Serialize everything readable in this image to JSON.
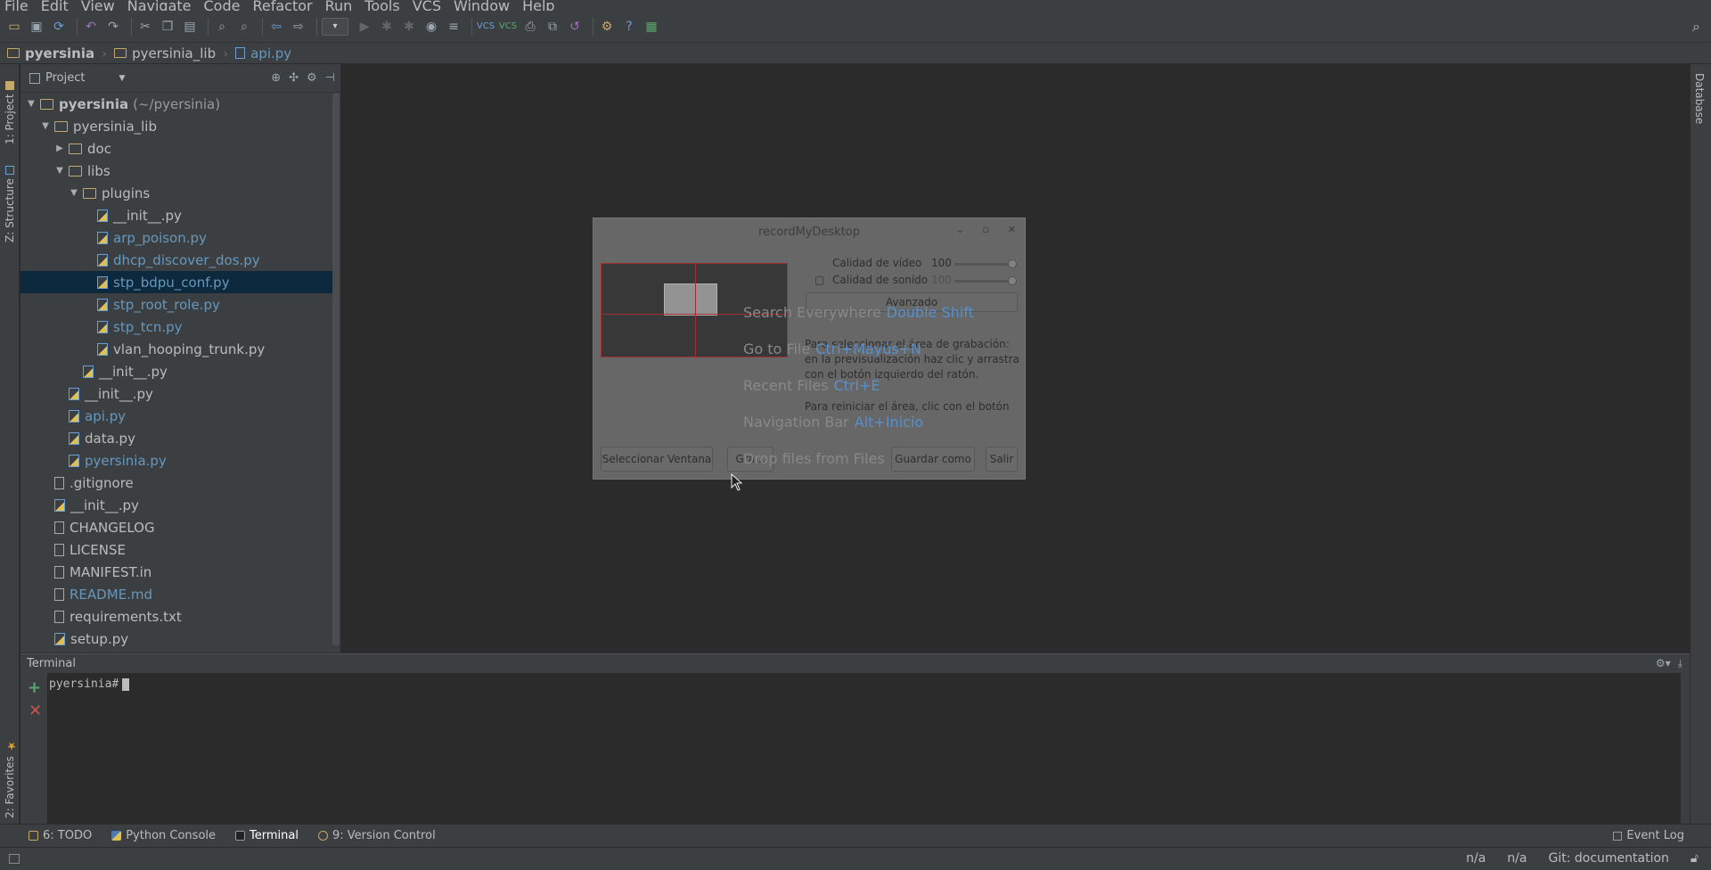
{
  "menu": [
    "File",
    "Edit",
    "View",
    "Navigate",
    "Code",
    "Refactor",
    "Run",
    "Tools",
    "VCS",
    "Window",
    "Help"
  ],
  "breadcrumb": [
    "pyersinia",
    "pyersinia_lib",
    "api.py"
  ],
  "left_tabs": {
    "project": "1: Project",
    "structure": "Z: Structure",
    "favorites": "2: Favorites"
  },
  "right_tabs": {
    "database": "Database"
  },
  "project_panel": {
    "title": "Project"
  },
  "tree": [
    {
      "name": "pyersinia",
      "suffix": "(~/pyersinia)",
      "type": "folder",
      "depth": 0,
      "expanded": true,
      "bold": true
    },
    {
      "name": "pyersinia_lib",
      "type": "folder",
      "depth": 1,
      "expanded": true
    },
    {
      "name": "doc",
      "type": "folder",
      "depth": 2,
      "expanded": false
    },
    {
      "name": "libs",
      "type": "folder",
      "depth": 2,
      "expanded": true
    },
    {
      "name": "plugins",
      "type": "folder",
      "depth": 3,
      "expanded": true
    },
    {
      "name": "__init__.py",
      "type": "py",
      "depth": 4
    },
    {
      "name": "arp_poison.py",
      "type": "py",
      "depth": 4,
      "modified": true
    },
    {
      "name": "dhcp_discover_dos.py",
      "type": "py",
      "depth": 4,
      "modified": true
    },
    {
      "name": "stp_bdpu_conf.py",
      "type": "py",
      "depth": 4,
      "modified": true,
      "selected": true
    },
    {
      "name": "stp_root_role.py",
      "type": "py",
      "depth": 4,
      "modified": true
    },
    {
      "name": "stp_tcn.py",
      "type": "py",
      "depth": 4,
      "modified": true
    },
    {
      "name": "vlan_hooping_trunk.py",
      "type": "py",
      "depth": 4
    },
    {
      "name": "__init__.py",
      "type": "py",
      "depth": 3
    },
    {
      "name": "__init__.py",
      "type": "py",
      "depth": 2
    },
    {
      "name": "api.py",
      "type": "py",
      "depth": 2,
      "modified": true
    },
    {
      "name": "data.py",
      "type": "py",
      "depth": 2
    },
    {
      "name": "pyersinia.py",
      "type": "py",
      "depth": 2,
      "modified": true
    },
    {
      "name": ".gitignore",
      "type": "txt",
      "depth": 1
    },
    {
      "name": "__init__.py",
      "type": "py",
      "depth": 1
    },
    {
      "name": "CHANGELOG",
      "type": "txt",
      "depth": 1
    },
    {
      "name": "LICENSE",
      "type": "txt",
      "depth": 1
    },
    {
      "name": "MANIFEST.in",
      "type": "txt",
      "depth": 1
    },
    {
      "name": "README.md",
      "type": "txt",
      "depth": 1,
      "modified": true
    },
    {
      "name": "requirements.txt",
      "type": "txt",
      "depth": 1
    },
    {
      "name": "setup.py",
      "type": "py",
      "depth": 1
    }
  ],
  "dialog": {
    "title": "recordMyDesktop",
    "video_quality_label": "Calidad de vídeo",
    "video_quality_value": "100",
    "sound_quality_label": "Calidad de sonido",
    "sound_quality_value": "100",
    "advanced_button": "Avanzado",
    "para1": [
      "Para seleccionar el área de grabación:",
      "en la previsualización haz clic y arrastra",
      "con el botón izquierdo del ratón."
    ],
    "para2": [
      "Para reiniciar el área, clic con el botón"
    ],
    "buttons": {
      "select_window": "Seleccionar Ventana",
      "record": "Gra...",
      "save_as": "Guardar como",
      "exit": "Salir"
    }
  },
  "editor_hints": [
    {
      "label": "Search Everywhere",
      "key": "Double Shift"
    },
    {
      "label": "Go to File",
      "key": "Ctrl+Mayús+N"
    },
    {
      "label": "Recent Files",
      "key": "Ctrl+E"
    },
    {
      "label": "Navigation Bar",
      "key": "Alt+Inicio"
    },
    {
      "label": "Drop files from Files",
      "key": ""
    }
  ],
  "terminal": {
    "title": "Terminal",
    "prompt": "pyersinia#"
  },
  "tool_tabs": [
    {
      "label": "6: TODO",
      "active": false
    },
    {
      "label": "Python Console",
      "active": false
    },
    {
      "label": "Terminal",
      "active": true
    },
    {
      "label": "9: Version Control",
      "active": false
    }
  ],
  "event_log": "Event Log",
  "status": {
    "pos1": "n/a",
    "pos2": "n/a",
    "git": "Git: documentation"
  }
}
